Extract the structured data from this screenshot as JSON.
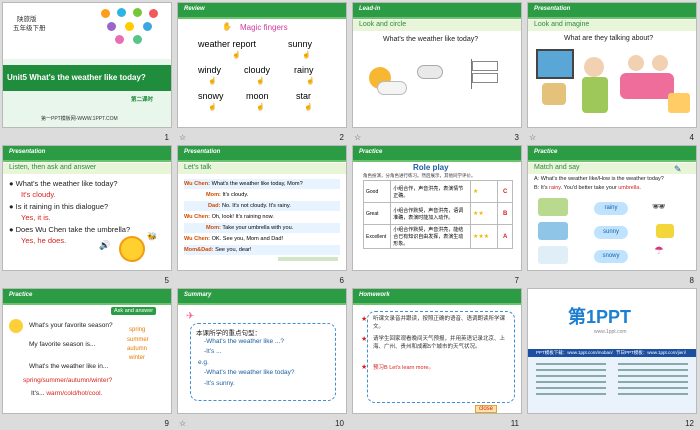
{
  "slides": [
    {
      "number": "1",
      "publisher": "陕旅版",
      "grade": "五年级下册",
      "title": "Unit5 What's the weather like today?",
      "lesson": "第二课时",
      "footer": "第一PPT模板网-WWW.1PPT.COM"
    },
    {
      "number": "2",
      "header": "Review",
      "heading": "Magic fingers",
      "words": [
        "weather report",
        "sunny",
        "windy",
        "cloudy",
        "rainy",
        "snowy",
        "moon",
        "star"
      ]
    },
    {
      "number": "3",
      "header": "Lead-in",
      "subheader": "Look and circle",
      "question": "What's the weather like today?"
    },
    {
      "number": "4",
      "header": "Presentation",
      "subheader": "Look and imagine",
      "question": "What are they talking  about?"
    },
    {
      "number": "5",
      "header": "Presentation",
      "subheader": "Listen, then ask and answer",
      "qa": [
        {
          "q": "What's the weather like today?",
          "a": "It's cloudy."
        },
        {
          "q": "Is it raining  in this dialogue?",
          "a": "Yes, it is."
        },
        {
          "q": "Does Wu Chen take the umbrella?",
          "a": "Yes, he does."
        }
      ]
    },
    {
      "number": "6",
      "header": "Presentation",
      "subheader": "Let's talk",
      "lines": [
        {
          "speaker": "Wu Chen:",
          "text": "What's the weather like today, Mom?"
        },
        {
          "speaker": "Mom:",
          "text": "It's cloudy."
        },
        {
          "speaker": "Dad:",
          "text": "No. It's not cloudy. It's rainy."
        },
        {
          "speaker": "Wu Chen:",
          "text": "Oh, look! It's raining now."
        },
        {
          "speaker": "Mom:",
          "text": "Take your umbrella with you."
        },
        {
          "speaker": "Wu Chen:",
          "text": "OK. See you, Mom and Dad!"
        },
        {
          "speaker": "Mom&Dad:",
          "text": "See you, dear!"
        }
      ]
    },
    {
      "number": "7",
      "header": "Practice",
      "title": "Role play",
      "intro": "角色扮演，分角色进行练习。然后展示，其他同学评价。",
      "rows": [
        {
          "level": "Good",
          "desc": "小组合作，声音洪亮，表演情节正确。",
          "stars": "★",
          "grade": "C"
        },
        {
          "level": "Great",
          "desc": "小组合作默契，声音洪亮，语调准确，表演时能加入动作。",
          "stars": "★★",
          "grade": "B"
        },
        {
          "level": "Excellent",
          "desc": "小组合作默契，声音洪亮，能结合已有知识自由发挥，表演生动形象。",
          "stars": "★★★",
          "grade": "A"
        }
      ]
    },
    {
      "number": "8",
      "header": "Practice",
      "subheader": "Match and say",
      "line_a": "A: What's the weather like/How is the weather today?",
      "line_b_pre": "B: It's ",
      "line_b_word": "rainy",
      "line_b_mid": ". You'd better take your ",
      "line_b_obj": "umbrella",
      "line_b_end": ".",
      "options": [
        "rainy",
        "sunny",
        "snowy"
      ]
    },
    {
      "number": "9",
      "header": "Practice",
      "tag": "Ask and answer",
      "q1": "What's your favorite  season?",
      "a1": "My  favorite  season is...",
      "seasons": [
        "spring",
        "summer",
        "autumn",
        "winter"
      ],
      "q2": "What's the weather like in...",
      "list": "spring/summer/autumn/winter?",
      "reply_pre": "It's... ",
      "reply_words": "warm/cold/hot/cool."
    },
    {
      "number": "10",
      "header": "Summary",
      "heading": "本课所学的重点句型：",
      "s1": "-What's the weather like ...?",
      "s2": "-It's ...",
      "eg": "e.g.",
      "s3": "-What's the weather like today?",
      "s4": "-It's sunny."
    },
    {
      "number": "11",
      "header": "Homework",
      "items": [
        "听课文录音并跟读，按照正确的语音、语调朗读所学课文。",
        "请学生回家观看晚间天气预报，并用英语记录北京、上海、广州、贵州和成都5个城市的天气状况。",
        "预习B Let's learn more。"
      ],
      "close": "close"
    },
    {
      "number": "12",
      "logo": "第1PPT",
      "logo_en": "www.1ppt.com",
      "caption_left": "PPT模板下载：www.1ppt.com/moban/",
      "caption_right": "节日PPT模板：www.1ppt.com/jieri/"
    }
  ]
}
